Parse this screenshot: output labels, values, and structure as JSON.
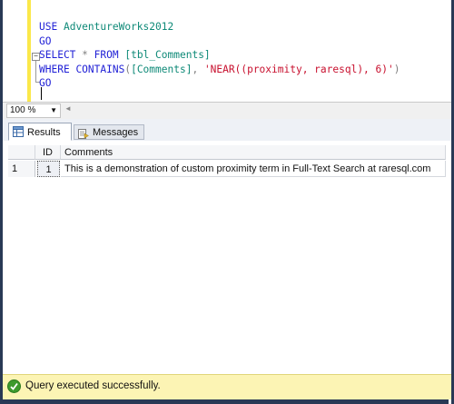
{
  "editor": {
    "lines": {
      "l1": {
        "kw": "USE",
        "obj": "AdventureWorks2012"
      },
      "l2": {
        "kw": "GO"
      },
      "l3": {
        "kw": "SELECT",
        "star": "*",
        "from": "FROM",
        "table": "[tbl_Comments]"
      },
      "l4": {
        "kw": "WHERE",
        "fn": "CONTAINS",
        "open": "(",
        "col": "[Comments]",
        "comma": ",",
        "str": "'NEAR((proximity, raresql), 6)'",
        "close": ")"
      },
      "l5": {
        "kw": "GO"
      }
    }
  },
  "zoom": {
    "value": "100 %"
  },
  "tabs": {
    "results": "Results",
    "messages": "Messages"
  },
  "grid": {
    "columns": [
      "ID",
      "Comments"
    ],
    "rows": [
      {
        "rownum": "1",
        "id": "1",
        "comment": "This is a demonstration of custom proximity term in Full-Text Search at raresql.com"
      }
    ]
  },
  "status": {
    "text": "Query executed successfully."
  },
  "colors": {
    "accent_yellow": "#fbe84a",
    "frame": "#293955",
    "status_bg": "#fcf4b4",
    "success_green": "#3d9a2c"
  }
}
